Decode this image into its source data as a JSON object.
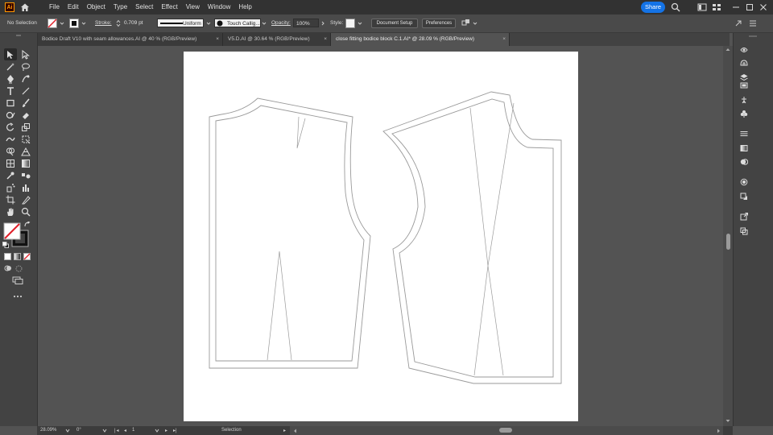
{
  "app": {
    "logo": "Ai",
    "share_label": "Share"
  },
  "menus": [
    "File",
    "Edit",
    "Object",
    "Type",
    "Select",
    "Effect",
    "View",
    "Window",
    "Help"
  ],
  "control_bar": {
    "selection_label": "No Selection",
    "stroke_label": "Stroke:",
    "stroke_value": "0.709 pt",
    "profile_value": "Uniform",
    "brush_value": "Touch Callig...",
    "opacity_label": "Opacity:",
    "opacity_value": "100%",
    "style_label": "Style:",
    "document_setup_label": "Document Setup",
    "preferences_label": "Preferences"
  },
  "tabs": [
    {
      "label": "Bodice Draft V10 with seam allowances.AI @ 40 % (RGB/Preview)"
    },
    {
      "label": "V5.D.AI @ 30.64 % (RGB/Preview)"
    },
    {
      "label": "close fitting bodice block C.1.AI* @ 28.09 % (RGB/Preview)"
    }
  ],
  "status_bar": {
    "zoom": "28.09%",
    "rotation": "0°",
    "artboard_number": "1",
    "current_tool": "Selection"
  },
  "colors": {
    "accent": "#1473e6",
    "logo_orange": "#ff9a00",
    "pattern_line": "#9a9a9a"
  }
}
